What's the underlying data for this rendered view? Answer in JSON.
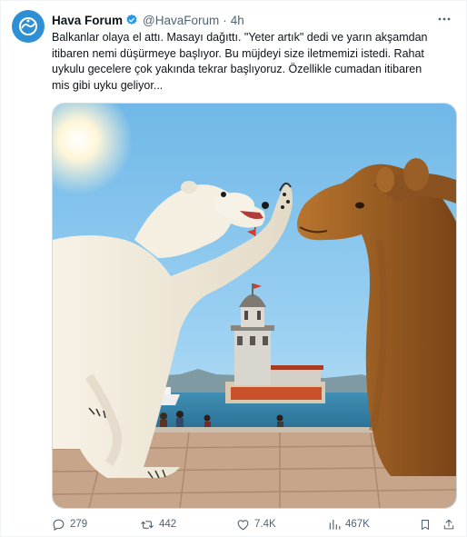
{
  "tweet": {
    "author_name": "Hava Forum",
    "handle": "@HavaForum",
    "separator": "·",
    "time": "4h",
    "text": "Balkanlar olaya el attı. Masayı dağıttı. \"Yeter artık\" dedi ve yarın akşamdan\nitibaren nemi düşürmeye başlıyor. Bu müjdeyi size iletmemizi istedi. Rahat\nuykulu gecelere çok yakında tekrar başlıyoruz. Özellikle cumadan itibaren\nmis gibi uyku geliyor...",
    "media_alt": "Polar bear giving a high five to a camel in front of Maiden's Tower, Istanbul"
  },
  "actions": {
    "replies": "279",
    "retweets": "442",
    "likes": "7.4K",
    "views": "467K"
  },
  "colors": {
    "brand_blue": "#1d9bf0",
    "avatar_bg": "#2f8fd4",
    "muted_text": "#536471",
    "border": "#cfd9de"
  },
  "icons": [
    "weather-logo-icon",
    "verified-badge-icon",
    "more-icon",
    "reply-icon",
    "retweet-icon",
    "like-icon",
    "views-icon",
    "bookmark-icon",
    "share-icon"
  ]
}
